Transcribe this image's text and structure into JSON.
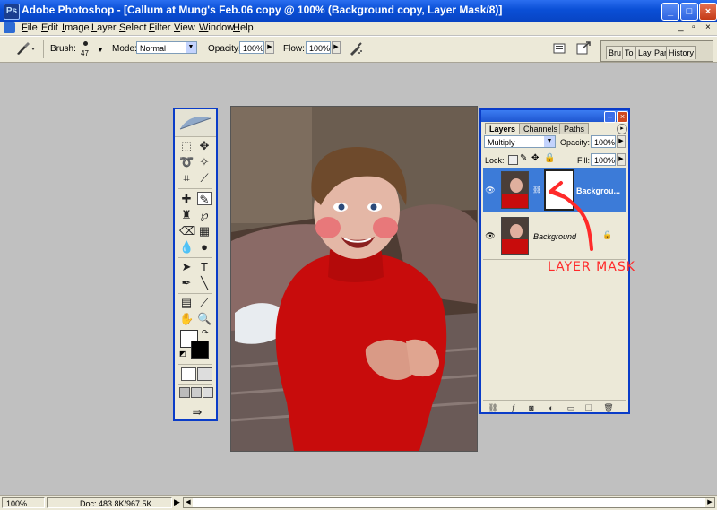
{
  "window": {
    "title": "Adobe Photoshop - [Callum at Mung's Feb.06 copy @ 100% (Background copy, Layer Mask/8)]",
    "app_icon": "Ps",
    "controls": {
      "minimize": "_",
      "maximize": "□",
      "close": "×"
    }
  },
  "menubar": {
    "items": [
      {
        "u": "F",
        "rest": "ile"
      },
      {
        "u": "E",
        "rest": "dit"
      },
      {
        "u": "I",
        "rest": "mage"
      },
      {
        "u": "L",
        "rest": "ayer"
      },
      {
        "u": "S",
        "rest": "elect"
      },
      {
        "u": "F",
        "rest": "ilter"
      },
      {
        "u": "V",
        "rest": "iew"
      },
      {
        "u": "W",
        "rest": "indow"
      },
      {
        "u": "H",
        "rest": "elp"
      }
    ],
    "doc_controls": {
      "minimize": "_",
      "restore": "▫",
      "close": "×"
    }
  },
  "options": {
    "brush_label": "Brush:",
    "brush_size": "47",
    "mode_label": "Mode:",
    "mode_value": "Normal",
    "opacity_label": "Opacity:",
    "opacity_value": "100%",
    "flow_label": "Flow:",
    "flow_value": "100%",
    "well_tabs": [
      "Bru",
      "To",
      "Lay",
      "Par",
      "History"
    ]
  },
  "layers_panel": {
    "tabs": [
      "Layers",
      "Channels",
      "Paths"
    ],
    "blend_mode": "Multiply",
    "opacity_label": "Opacity:",
    "opacity_value": "100%",
    "lock_label": "Lock:",
    "fill_label": "Fill:",
    "fill_value": "100%",
    "layers": [
      {
        "name": "Backgrou...",
        "selected": true
      },
      {
        "name": "Background",
        "selected": false
      }
    ]
  },
  "annotation": {
    "text": "LAYER MASK",
    "color": "#ff2a2a"
  },
  "statusbar": {
    "zoom": "100%",
    "doc": "Doc: 483.8K/967.5K",
    "arrow": "▶"
  },
  "colors": {
    "accent": "#0a3cc8",
    "selection": "#3c7bd8",
    "chrome": "#ece9d8",
    "workspace": "#c0c0c0"
  }
}
